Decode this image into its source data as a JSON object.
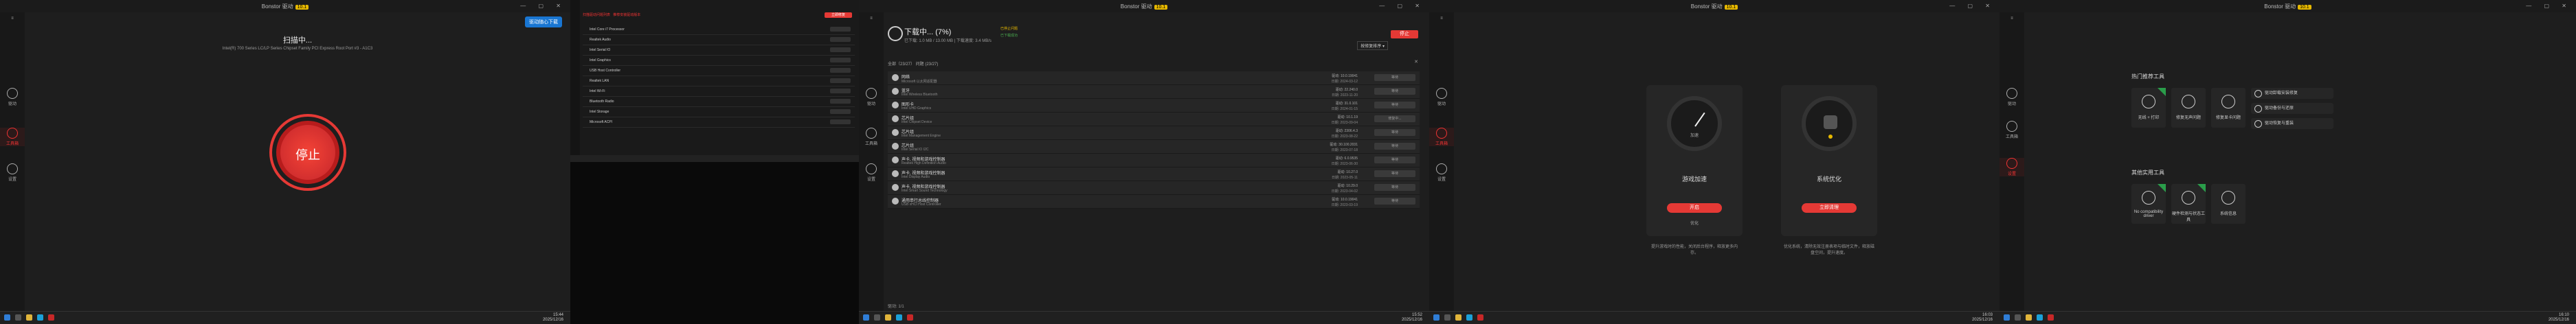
{
  "app": {
    "title": "Bonstor 驱动",
    "version": "10.1"
  },
  "panel1": {
    "promo_button": "驱动随心下载",
    "status_title": "扫描中...",
    "status_detail": "Intel(R) 700 Series LC/LP Series Chipset Family PCI Express Root Port #3 - A1C3",
    "stop_label": "停止",
    "sidebar": [
      "驱动",
      "工具箱",
      "设置"
    ],
    "clock": {
      "time": "15:44",
      "date": "2025/12/16"
    }
  },
  "panel2": {
    "header_left": "扫描驱动问题列表",
    "header_mid": "推荐安装驱动版本",
    "button": "立即修复",
    "rows": [
      "Intel Core i7 Processor",
      "Realtek Audio",
      "Intel Serial IO",
      "Intel Graphics",
      "USB Host Controller",
      "Realtek LAN",
      "Intel Wi-Fi",
      "Bluetooth Radio",
      "Intel Storage",
      "Microsoft ACPI"
    ]
  },
  "panel3": {
    "status_title": "下载中... (7%)",
    "status_detail": "已下载: 1.0 MB / 13.00 MB | 下载速度: 3.4 MB/s",
    "tag1": "已停止问题",
    "tag2": "已下载成功",
    "sort_label": "按修复排序",
    "stop_button": "停止",
    "filter_text": "全部（23/27）  问题 (23/27)",
    "rows": [
      {
        "name": "网络",
        "sub": "Microsoft 以太网适配器",
        "ver": "驱动: 10.0.19041",
        "date": "日期: 2024-03-12",
        "action": "等待"
      },
      {
        "name": "蓝牙",
        "sub": "Intel Wireless Bluetooth",
        "ver": "驱动: 22.240.0",
        "date": "日期: 2023-11-20",
        "action": "等待"
      },
      {
        "name": "图形卡",
        "sub": "Intel UHD Graphics",
        "ver": "驱动: 31.0.101",
        "date": "日期: 2024-01-15",
        "action": "等待"
      },
      {
        "name": "芯片组",
        "sub": "Intel Chipset Device",
        "ver": "驱动: 10.1.19",
        "date": "日期: 2023-09-04",
        "action": "修复中..."
      },
      {
        "name": "芯片组",
        "sub": "Intel Management Engine",
        "ver": "驱动: 2306.4.3",
        "date": "日期: 2023-08-22",
        "action": "等待"
      },
      {
        "name": "芯片组",
        "sub": "Intel Serial IO I2C",
        "ver": "驱动: 30.100.2031",
        "date": "日期: 2023-07-18",
        "action": "等待"
      },
      {
        "name": "声卡, 视频和游戏控制器",
        "sub": "Realtek High Definition Audio",
        "ver": "驱动: 6.0.9535",
        "date": "日期: 2023-06-30",
        "action": "等待"
      },
      {
        "name": "声卡, 视频和游戏控制器",
        "sub": "Intel Display Audio",
        "ver": "驱动: 10.27.0",
        "date": "日期: 2023-05-11",
        "action": "等待"
      },
      {
        "name": "声卡, 视频和游戏控制器",
        "sub": "Intel Smart Sound Technology",
        "ver": "驱动: 10.29.0",
        "date": "日期: 2023-04-02",
        "action": "等待"
      },
      {
        "name": "通用串行总线控制器",
        "sub": "USB xHCI Host Controller",
        "ver": "驱动: 10.0.19041",
        "date": "日期: 2023-03-19",
        "action": "等待"
      }
    ],
    "footer": "驱动: 1/1",
    "clock": {
      "time": "15:52",
      "date": "2025/12/16"
    }
  },
  "panel4": {
    "left_title": "游戏加速",
    "left_button": "开启",
    "left_note": "优化",
    "left_desc": "提升游戏时的性能，关闭后台程序，释放更多内存。",
    "gauge_label": "加速",
    "right_title": "系统优化",
    "right_button": "立即清理",
    "right_desc": "优化系统，清除无效注册表项与临时文件，释放磁盘空间，提升速度。",
    "clock": {
      "time": "16:03",
      "date": "2025/12/16"
    }
  },
  "panel5": {
    "section1": "热门推荐工具",
    "section2": "其他实用工具",
    "cards1": [
      "无线 + 打印",
      "修复无声问题",
      "修复显卡问题"
    ],
    "pills": [
      "驱动卸载安装修复",
      "驱动备份与还原",
      "驱动恢复与重装"
    ],
    "cards2": [
      "No compatibility driver",
      "硬件检测与状态工具",
      "系统信息"
    ],
    "clock": {
      "time": "16:10",
      "date": "2025/12/16"
    }
  }
}
